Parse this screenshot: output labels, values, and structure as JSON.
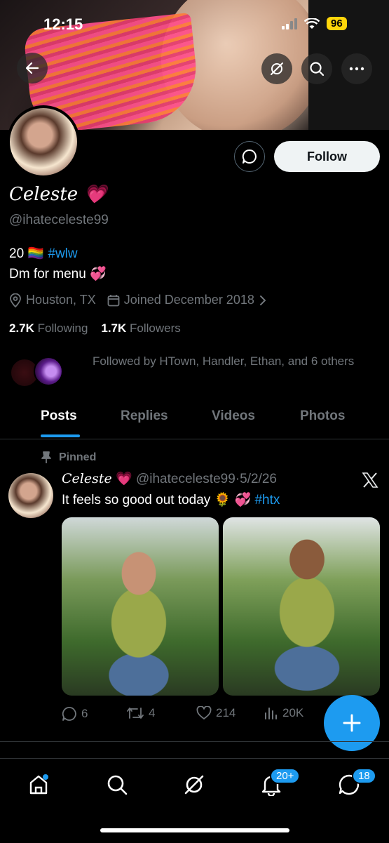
{
  "status_bar": {
    "time": "12:15",
    "battery": "96"
  },
  "profile": {
    "name": "Celeste",
    "name_emoji": "💗",
    "handle": "@ihateceleste99",
    "bio_line1_prefix": "20 ",
    "bio_flag": "🏳️‍🌈",
    "bio_hashtag": "#wlw",
    "bio_line2": "Dm for menu",
    "bio_line2_emoji": "💞",
    "location": "Houston, TX",
    "joined": "Joined December 2018",
    "following_count": "2.7K",
    "following_label": "Following",
    "followers_count": "1.7K",
    "followers_label": "Followers",
    "followed_by": "Followed by HTown, Handler, Ethan, and 6 others",
    "follow_button": "Follow"
  },
  "tabs": [
    {
      "label": "Posts"
    },
    {
      "label": "Replies"
    },
    {
      "label": "Videos"
    },
    {
      "label": "Photos"
    }
  ],
  "post": {
    "pinned_label": "Pinned",
    "author_name": "Celeste",
    "author_emoji": "💗",
    "handle": "@ihateceleste99",
    "separator": "·",
    "date": "5/2/26",
    "text": "It feels so good out today",
    "text_emoji": "🌻 💞",
    "hashtag": "#htx",
    "replies": "6",
    "reposts": "4",
    "likes": "214",
    "views": "20K"
  },
  "nav": {
    "notifications_badge": "20+",
    "messages_badge": "18"
  },
  "colors": {
    "accent": "#1d9bf0",
    "muted": "#71767b",
    "background": "#000000"
  }
}
